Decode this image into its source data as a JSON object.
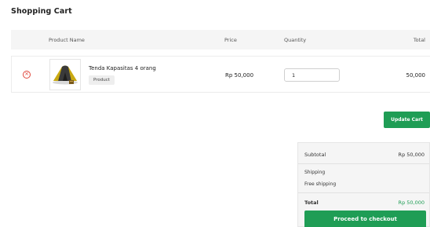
{
  "page": {
    "title": "Shopping Cart"
  },
  "table": {
    "headers": {
      "product_name": "Product Name",
      "price": "Price",
      "quantity": "Quantity",
      "total": "Total"
    },
    "rows": [
      {
        "remove_icon": "remove-circle-icon",
        "thumbnail": "tent-image",
        "name": "Tenda Kapasitas 4 orang",
        "badge": "Product",
        "price": "Rp 50,000",
        "quantity": "1",
        "total": "50,000"
      }
    ]
  },
  "actions": {
    "update_cart_label": "Update Cart"
  },
  "totals": {
    "subtotal_label": "Subtotal",
    "subtotal_value": "Rp 50,000",
    "shipping_label": "Shipping",
    "shipping_method": "Free shipping",
    "total_label": "Total",
    "total_value": "Rp 50,000",
    "checkout_label": "Proceed to checkout"
  },
  "colors": {
    "accent": "#1f9d55",
    "remove": "#e0463b",
    "header_bg": "#f5f5f5"
  }
}
